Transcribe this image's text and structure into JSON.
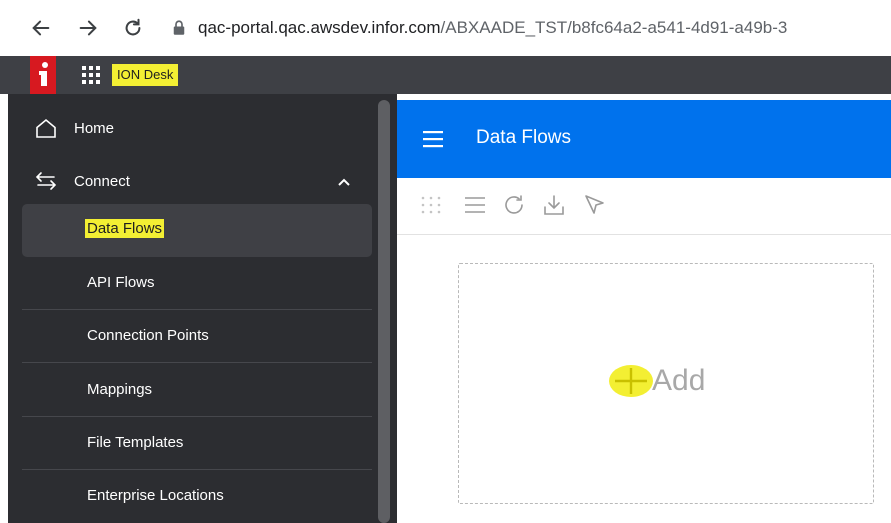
{
  "browser": {
    "url_host": "qac-portal.qac.awsdev.infor.com",
    "url_path": "/ABXAADE_TST/b8fc64a2-a541-4d91-a49b-3"
  },
  "app": {
    "name": "ION Desk",
    "highlight_color": "#f3ef33",
    "header_color": "#3e4045",
    "brand_color": "#d71920"
  },
  "sidebar": {
    "home_label": "Home",
    "connect_label": "Connect",
    "items": [
      {
        "label": "Data Flows",
        "active": true
      },
      {
        "label": "API Flows"
      },
      {
        "label": "Connection Points"
      },
      {
        "label": "Mappings"
      },
      {
        "label": "File Templates"
      },
      {
        "label": "Enterprise Locations"
      }
    ]
  },
  "main": {
    "title": "Data Flows",
    "header_color": "#0072ed",
    "add_label": "Add"
  }
}
